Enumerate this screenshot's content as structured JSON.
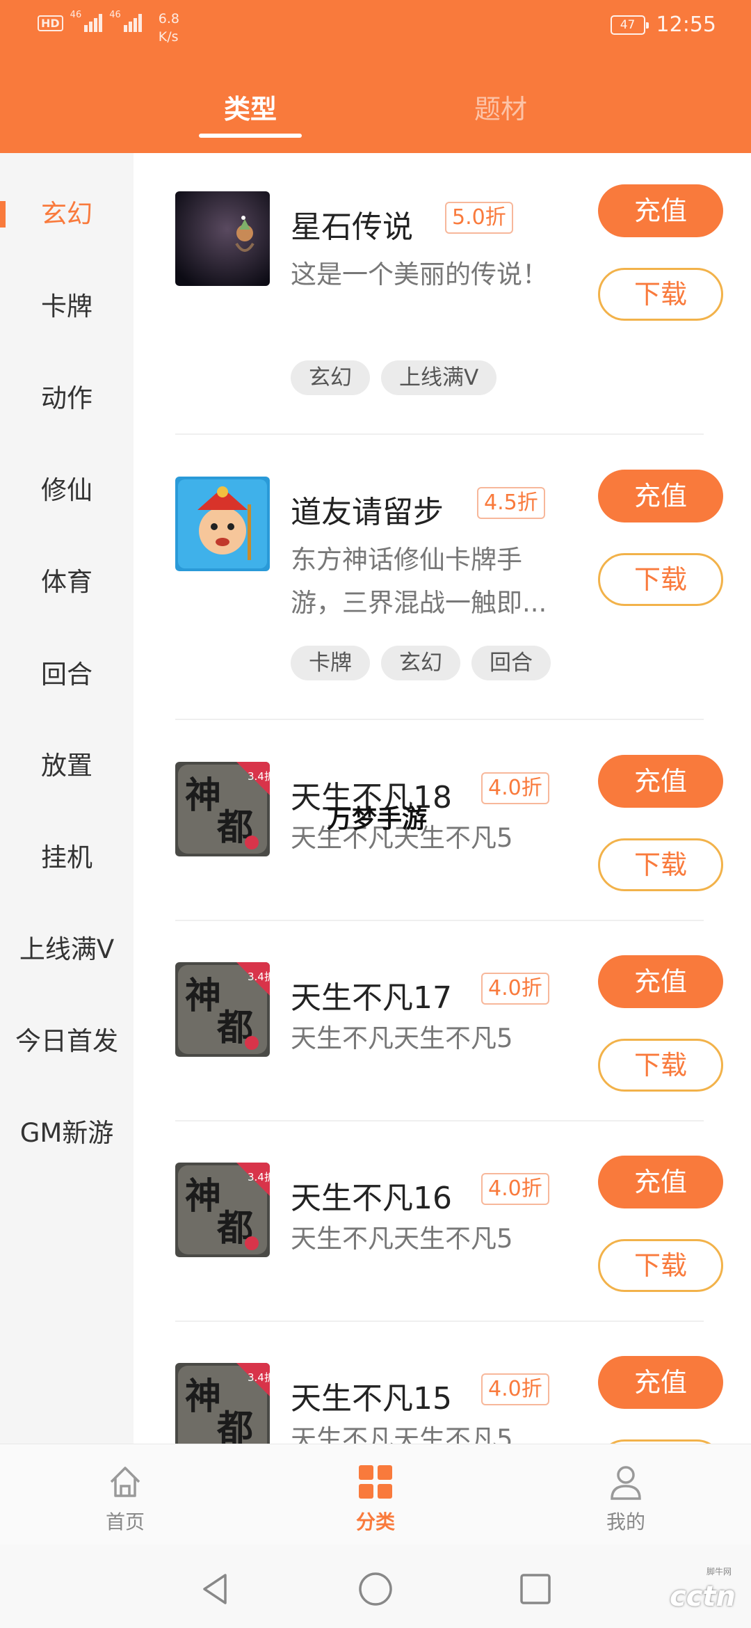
{
  "status_bar": {
    "hd": "HD",
    "net1": "46",
    "net2": "46",
    "speed_value": "6.8",
    "speed_unit": "K/s",
    "battery": "47",
    "time": "12:55"
  },
  "tabs": [
    {
      "label": "类型",
      "active": true
    },
    {
      "label": "题材",
      "active": false
    }
  ],
  "sidebar": {
    "items": [
      {
        "label": "玄幻"
      },
      {
        "label": "卡牌"
      },
      {
        "label": "动作"
      },
      {
        "label": "修仙"
      },
      {
        "label": "体育"
      },
      {
        "label": "回合"
      },
      {
        "label": "放置"
      },
      {
        "label": "挂机"
      },
      {
        "label": "上线满V"
      },
      {
        "label": "今日首发"
      },
      {
        "label": "GM新游"
      }
    ]
  },
  "games": [
    {
      "name": "星石传说",
      "discount": "5.0折",
      "desc": "这是一个美丽的传说！",
      "tags": [
        "玄幻",
        "上线满V"
      ],
      "charge": "充值",
      "download": "下载",
      "icon": "xingshi-icon"
    },
    {
      "name": "道友请留步",
      "discount": "4.5折",
      "desc": "东方神话修仙卡牌手游，三界混战一触即...",
      "tags": [
        "卡牌",
        "玄幻",
        "回合"
      ],
      "charge": "充值",
      "download": "下载",
      "icon": "daoyou-icon"
    },
    {
      "name": "天生不凡18",
      "discount": "4.0折",
      "desc": "天生不凡天生不凡5",
      "tags": [],
      "charge": "充值",
      "download": "下载",
      "icon": "shendu-icon"
    },
    {
      "name": "天生不凡17",
      "discount": "4.0折",
      "desc": "天生不凡天生不凡5",
      "tags": [],
      "charge": "充值",
      "download": "下载",
      "icon": "shendu-icon"
    },
    {
      "name": "天生不凡16",
      "discount": "4.0折",
      "desc": "天生不凡天生不凡5",
      "tags": [],
      "charge": "充值",
      "download": "下载",
      "icon": "shendu-icon"
    },
    {
      "name": "天生不凡15",
      "discount": "4.0折",
      "desc": "天生不凡天生不凡5",
      "tags": [],
      "charge": "充值",
      "download": "下载",
      "icon": "shendu-icon"
    }
  ],
  "icon_badge": "3.4折",
  "watermark": "万梦手游",
  "bottom_nav": [
    {
      "label": "首页",
      "icon": "home-icon",
      "active": false
    },
    {
      "label": "分类",
      "icon": "category-grid-icon",
      "active": true
    },
    {
      "label": "我的",
      "icon": "profile-icon",
      "active": false
    }
  ],
  "brand_logo": "cctn",
  "brand_small": "脚牛网",
  "colors": {
    "accent": "#f97a3c",
    "download_border": "#f2b24a"
  }
}
